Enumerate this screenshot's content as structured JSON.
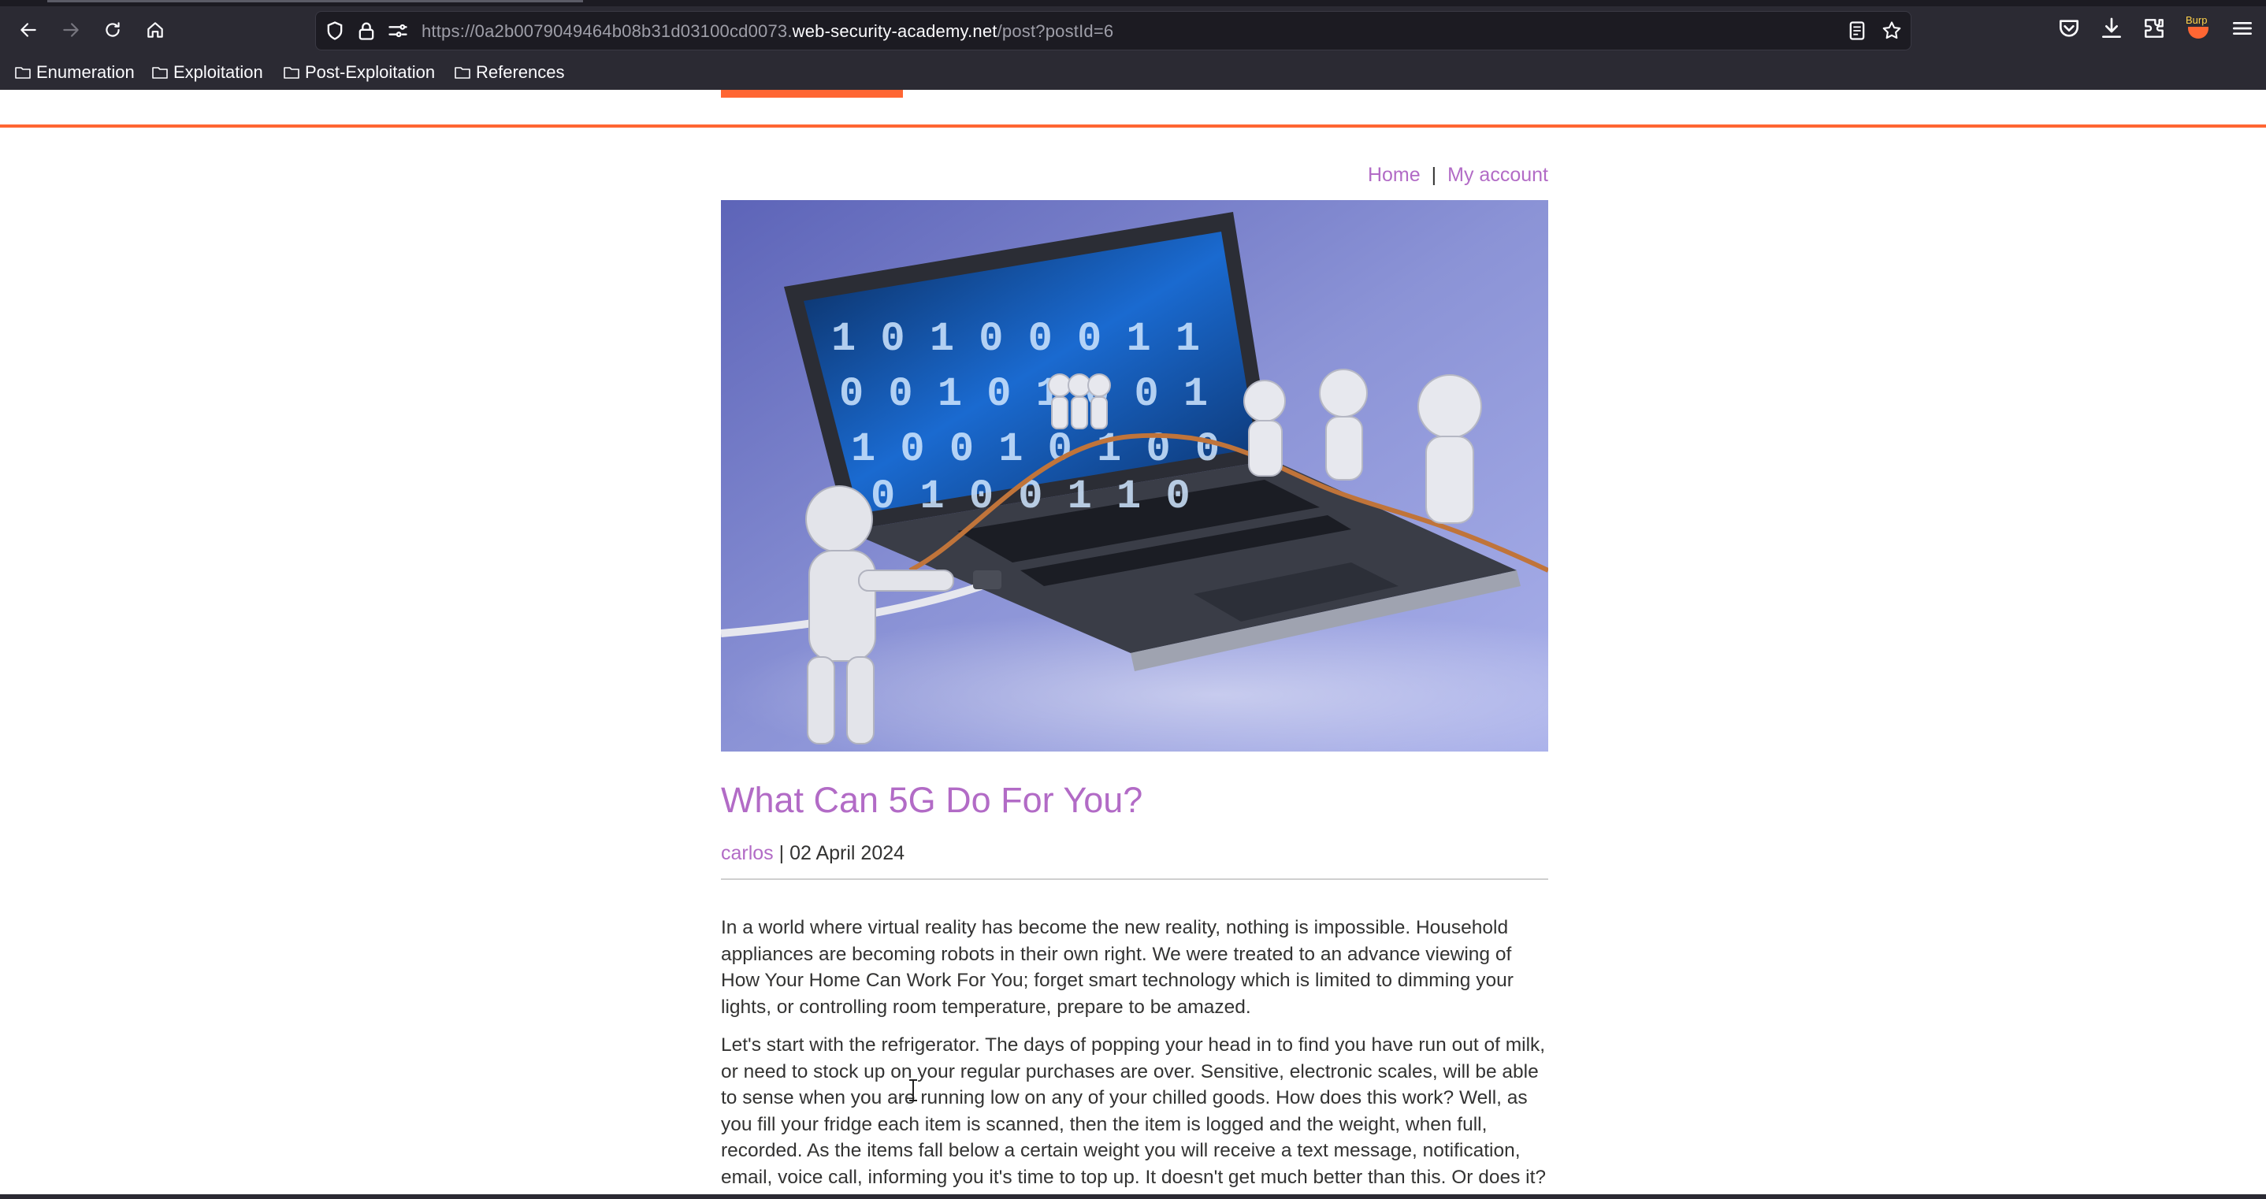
{
  "browser": {
    "url_prefix": "https://0a2b0079049464b08b31d03100cd0073.",
    "url_domain": "web-security-academy.net",
    "url_path": "/post?postId=6",
    "bookmarks": [
      {
        "label": "Enumeration"
      },
      {
        "label": "Exploitation"
      },
      {
        "label": "Post-Exploitation"
      },
      {
        "label": "References"
      }
    ],
    "extension_badge": "Burp",
    "icons": [
      "back-icon",
      "forward-icon",
      "reload-icon",
      "home-icon",
      "shield-icon",
      "lock-icon",
      "permissions-icon",
      "reader-view-icon",
      "star-icon",
      "pocket-icon",
      "downloads-icon",
      "extensions-icon",
      "burp-extension-icon",
      "menu-icon"
    ]
  },
  "colors": {
    "accent": "#ff6633",
    "link": "#b26bc6",
    "text": "#333332",
    "chrome_bg": "#2b2a33"
  },
  "nav": {
    "home": "Home",
    "separator": "|",
    "account": "My account"
  },
  "post": {
    "title": "What Can 5G Do For You?",
    "author": "carlos",
    "date_sep": "|",
    "date": "02 April 2024",
    "paragraphs": [
      "In a world where virtual reality has become the new reality, nothing is impossible. Household appliances are becoming robots in their own right. We were treated to an advance viewing of How Your Home Can Work For You; forget smart technology which is limited to dimming your lights, or controlling room temperature, prepare to be amazed.",
      "Let's start with the refrigerator. The days of popping your head in to find you have run out of milk, or need to stock up on your regular purchases are over. Sensitive, electronic scales, will be able to sense when you are running low on any of your chilled goods. How does this work? Well, as you fill your fridge each item is scanned, then the item is logged and the weight, when full, recorded. As the items fall below a certain weight you will receive a text message, notification, email, voice call, informing you it's time to top up. It doesn't get much better than this. Or does it?"
    ],
    "image_description_icon": "laptop-tug-of-war-image"
  }
}
